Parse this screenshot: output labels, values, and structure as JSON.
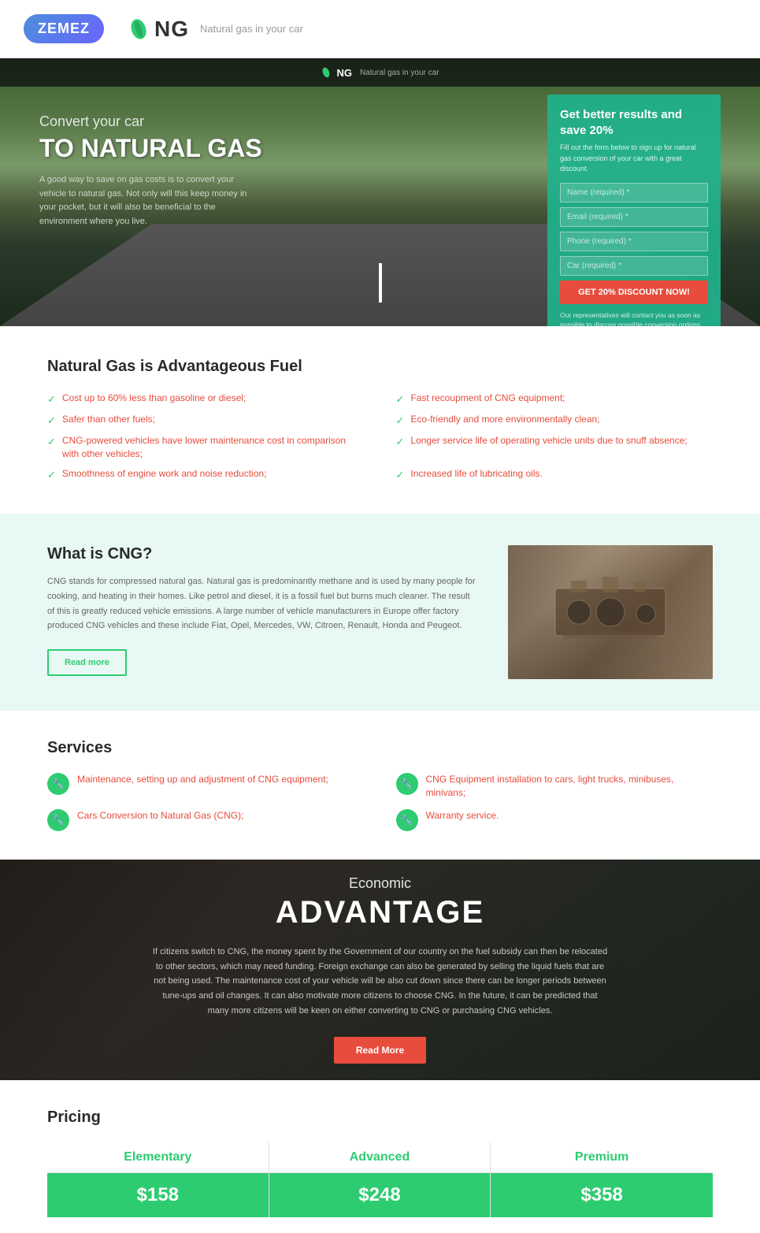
{
  "topbar": {
    "zemez_label": "ZEMEZ",
    "ng_brand": "NG",
    "ng_tagline": "Natural gas in your car"
  },
  "hero_nav": {
    "brand": "NG",
    "tagline": "Natural gas in your car"
  },
  "hero": {
    "subtitle": "Convert your car",
    "title": "TO NATURAL GAS",
    "description": "A good way to save on gas costs is to convert your vehicle to natural gas. Not only will this keep money in your pocket, but it will also be beneficial to the environment where you live."
  },
  "hero_form": {
    "title": "Get better results and save 20%",
    "description": "Fill out the form below to sign up for natural gas conversion of your car with a great discount.",
    "name_placeholder": "Name (required) *",
    "email_placeholder": "Email (required) *",
    "phone_placeholder": "Phone (required) *",
    "car_placeholder": "Car (required) *",
    "submit_label": "Get 20% discount now!",
    "footer_text": "Our representatives will contact you as soon as possible to discuss possible conversion options."
  },
  "advantages": {
    "section_title": "Natural Gas is Advantageous Fuel",
    "items": [
      {
        "text": "Cost up to 60% less than gasoline or diesel;"
      },
      {
        "text": "Fast recoupment of CNG equipment;"
      },
      {
        "text": "Safer than other fuels;"
      },
      {
        "text": "Eco-friendly and more environmentally clean;"
      },
      {
        "text": "CNG-powered vehicles have lower maintenance cost in comparison with other vehicles;"
      },
      {
        "text": "Longer service life of operating vehicle units due to snuff absence;"
      },
      {
        "text": "Smoothness of engine work and noise reduction;"
      },
      {
        "text": "Increased life of lubricating oils."
      }
    ]
  },
  "cng": {
    "title": "What is CNG?",
    "description": "CNG stands for compressed natural gas. Natural gas is predominantly methane and is used by many people for cooking, and heating in their homes. Like petrol and diesel, it is a fossil fuel but burns much cleaner. The result of this is greatly reduced vehicle emissions. A large number of vehicle manufacturers in Europe offer factory produced CNG vehicles and these include Fiat, Opel, Mercedes, VW, Citroen, Renault, Honda and Peugeot.",
    "read_more_label": "Read more"
  },
  "services": {
    "title": "Services",
    "items": [
      {
        "text": "Maintenance, setting up and adjustment of CNG equipment;"
      },
      {
        "text": "CNG Equipment installation to cars, light trucks, minibuses, minivans;"
      },
      {
        "text": "Cars Conversion to Natural Gas (CNG);"
      },
      {
        "text": "Warranty service."
      }
    ]
  },
  "economic": {
    "subtitle": "Economic",
    "title": "ADVANTAGE",
    "description": "If citizens switch to CNG, the money spent by the Government of our country on the fuel subsidy can then be relocated to other sectors, which may need funding. Foreign exchange can also be generated by selling the liquid fuels that are not being used. The maintenance cost of your vehicle will be also cut down since there can be longer periods between tune-ups and oil changes. It can also motivate more citizens to choose CNG. In the future, it can be predicted that many more citizens will be keen on either converting to CNG or purchasing CNG vehicles.",
    "read_more_label": "Read more"
  },
  "pricing": {
    "title": "Pricing",
    "plans": [
      {
        "name": "Elementary",
        "price": "$158"
      },
      {
        "name": "Advanced",
        "price": "$248"
      },
      {
        "name": "Premium",
        "price": "$358"
      }
    ]
  }
}
